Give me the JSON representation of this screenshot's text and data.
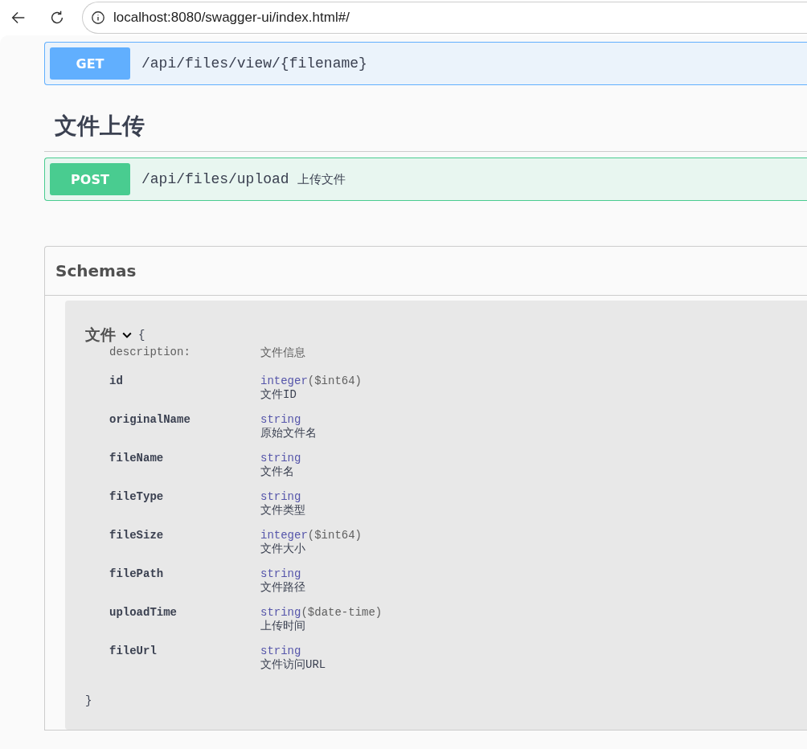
{
  "browser": {
    "url": "localhost:8080/swagger-ui/index.html#/"
  },
  "operations_top": [
    {
      "method": "GET",
      "path": "/api/files/view/{filename}"
    }
  ],
  "tag": {
    "title": "文件上传"
  },
  "operations": [
    {
      "method": "POST",
      "path": "/api/files/upload",
      "summary": "上传文件"
    }
  ],
  "schemas": {
    "title": "Schemas",
    "model": {
      "name": "文件",
      "expanded": true,
      "open_brace": "{",
      "close_brace": "}",
      "description_label": "description:",
      "description": "文件信息",
      "properties": [
        {
          "name": "id",
          "type": "integer",
          "format": "($int64)",
          "description": "文件ID"
        },
        {
          "name": "originalName",
          "type": "string",
          "description": "原始文件名"
        },
        {
          "name": "fileName",
          "type": "string",
          "description": "文件名"
        },
        {
          "name": "fileType",
          "type": "string",
          "description": "文件类型"
        },
        {
          "name": "fileSize",
          "type": "integer",
          "format": "($int64)",
          "description": "文件大小"
        },
        {
          "name": "filePath",
          "type": "string",
          "description": "文件路径"
        },
        {
          "name": "uploadTime",
          "type": "string",
          "format": "($date-time)",
          "description": "上传时间"
        },
        {
          "name": "fileUrl",
          "type": "string",
          "description": "文件访问URL"
        }
      ]
    }
  }
}
